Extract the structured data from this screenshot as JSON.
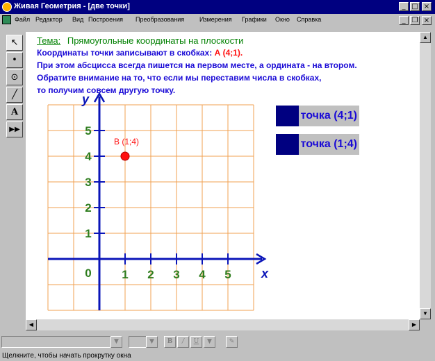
{
  "window": {
    "title": "Живая Геометрия - [две точки]",
    "minimize_glyph": "_",
    "maximize_glyph": "□",
    "close_glyph": "×",
    "restore_glyph": "❐"
  },
  "menu": {
    "items": [
      "Файл",
      "Редактор",
      "Вид",
      "Построения",
      "Преобразования",
      "Измерения",
      "Графики",
      "Окно",
      "Справка"
    ]
  },
  "tools": [
    {
      "name": "arrow-tool",
      "glyph": "↖"
    },
    {
      "name": "point-tool",
      "glyph": "•"
    },
    {
      "name": "compass-tool",
      "glyph": "⊙"
    },
    {
      "name": "straightedge-tool",
      "glyph": "╱"
    },
    {
      "name": "text-tool",
      "glyph": "A"
    },
    {
      "name": "script-tool",
      "glyph": "▶▶"
    }
  ],
  "content": {
    "topic_label": "Тема:",
    "topic_title": "Прямоугольные координаты на плоскости",
    "line1_prefix": "Координаты точки записывают в скобках:",
    "line1_example": "А (4;1).",
    "line2": "При этом абсцисса всегда пишется на первом месте, а ордината - на втором.",
    "line3": "Обратите внимание на то, что если мы переставим числа в скобках,",
    "line4": "то получим совсем другую точку."
  },
  "buttons": {
    "point_a": "точка (4;1)",
    "point_b": "точка (1;4)"
  },
  "chart_data": {
    "type": "scatter",
    "xlabel": "x",
    "ylabel": "y",
    "xlim": [
      -2,
      6
    ],
    "ylim": [
      -2,
      6
    ],
    "x_ticks": [
      "1",
      "2",
      "3",
      "4",
      "5"
    ],
    "y_ticks": [
      "1",
      "2",
      "3",
      "4",
      "5"
    ],
    "origin_label": "0",
    "grid": true,
    "points": [
      {
        "label": "В (1;4)",
        "x": 1,
        "y": 4
      }
    ]
  },
  "colors": {
    "axis_text": "#2e7d1e",
    "grid": "#f0a050",
    "point": "#ff1010",
    "text_blue": "#1a0ad6",
    "title_green": "#008000"
  },
  "status": {
    "text": "Щелкните, чтобы начать прокрутку окна"
  },
  "format_bar": {
    "bold": "B",
    "italic": "/",
    "underline": "U"
  }
}
